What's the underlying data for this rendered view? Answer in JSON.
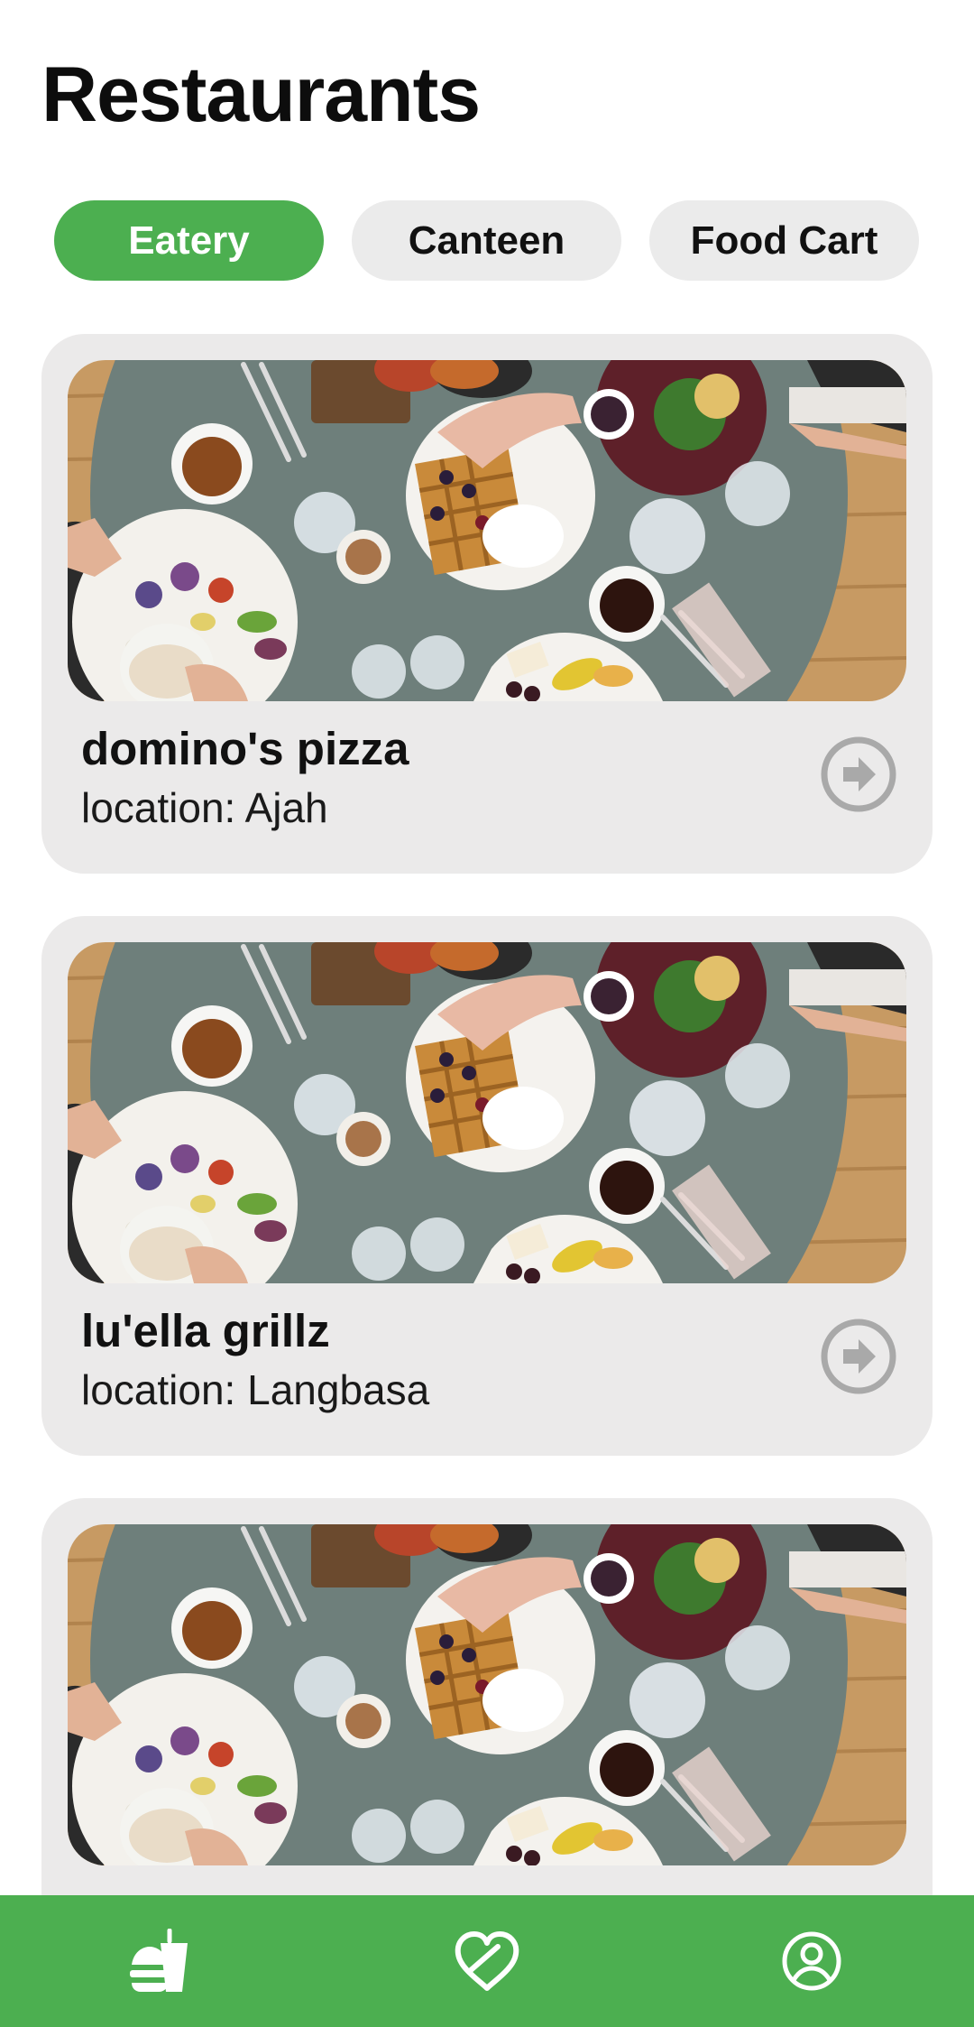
{
  "header": {
    "title": "Restaurants"
  },
  "tabs": [
    {
      "label": "Eatery",
      "active": true
    },
    {
      "label": "Canteen",
      "active": false
    },
    {
      "label": "Food Cart",
      "active": false
    }
  ],
  "restaurants": [
    {
      "name": "domino's pizza",
      "location": "location: Ajah"
    },
    {
      "name": "lu'ella grillz",
      "location": "location: Langbasa"
    },
    {
      "name": "",
      "location": ""
    }
  ],
  "bottom_nav": {
    "items": [
      {
        "icon": "food-icon"
      },
      {
        "icon": "heart-icon"
      },
      {
        "icon": "account-icon"
      }
    ]
  },
  "colors": {
    "accent": "#4caf50",
    "card_background": "#ebeaea",
    "chip_inactive": "#ebebeb",
    "arrow_icon": "#a9a9a9"
  }
}
